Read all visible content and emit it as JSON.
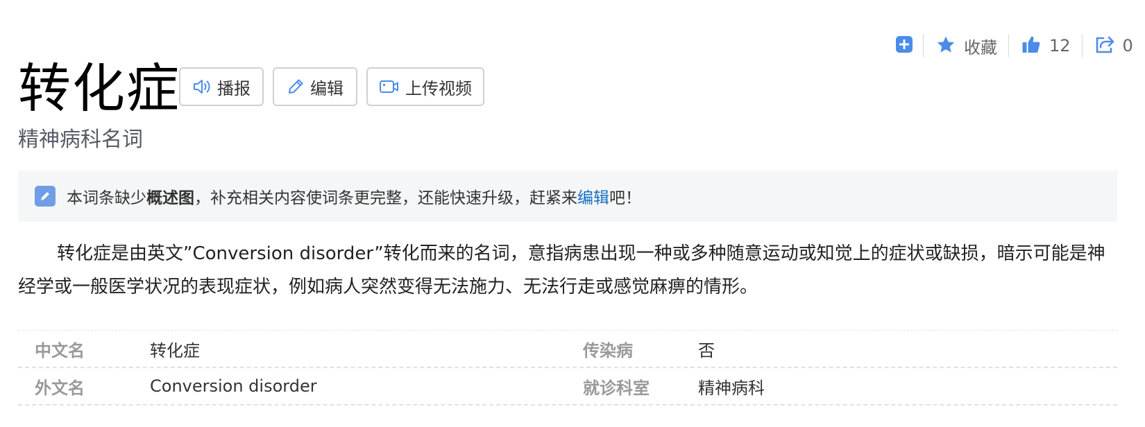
{
  "actions": {
    "add_icon": "plus-square-icon",
    "favorite_label": "收藏",
    "like_count": "12",
    "share_count": "0"
  },
  "title": "转化症",
  "subtitle": "精神病科名词",
  "tools": {
    "broadcast_label": "播报",
    "edit_label": "编辑",
    "upload_video_label": "上传视频"
  },
  "notice": {
    "prefix": "本词条缺少",
    "bold": "概述图",
    "middle": "，补充相关内容使词条更完整，还能快速升级，赶紧来",
    "link": "编辑",
    "suffix": "吧！"
  },
  "summary": "转化症是由英文”Conversion disorder”转化而来的名词，意指病患出现一种或多种随意运动或知觉上的症状或缺损，暗示可能是神经学或一般医学状况的表现症状，例如病人突然变得无法施力、无法行走或感觉麻痹的情形。",
  "info_rows": [
    {
      "k1": "中文名",
      "v1": "转化症",
      "k2": "传染病",
      "v2": "否"
    },
    {
      "k1": "外文名",
      "v1": "Conversion disorder",
      "k2": "就诊科室",
      "v2": "精神病科"
    }
  ],
  "colors": {
    "accent_icon": "#4a8ce8",
    "link": "#136ec2",
    "notice_bg": "#f5f6f7"
  }
}
